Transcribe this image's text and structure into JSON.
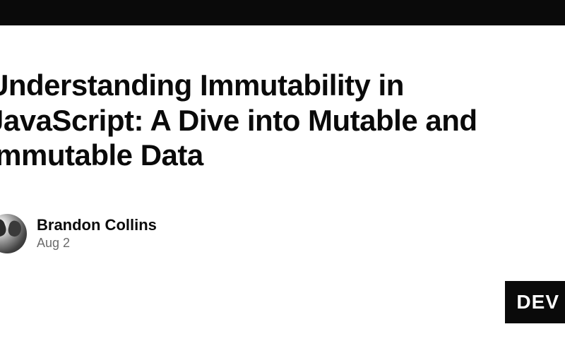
{
  "article": {
    "title": "Understanding Immutability in JavaScript: A Dive into Mutable and Immutable Data"
  },
  "author": {
    "name": "Brandon Collins",
    "date": "Aug 2"
  },
  "badge": {
    "text": "DEV"
  }
}
